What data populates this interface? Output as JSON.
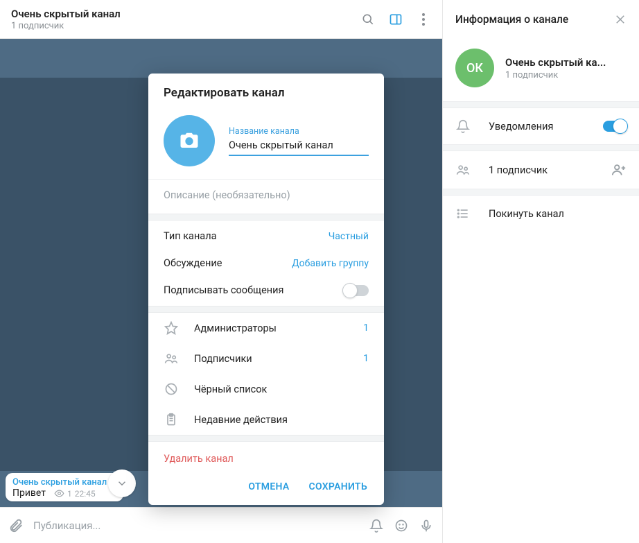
{
  "header": {
    "title": "Очень скрытый канал",
    "subtitle": "1 подписчик"
  },
  "message": {
    "channel": "Очень скрытый канал",
    "text": "Привет",
    "views": "1",
    "time": "22:45"
  },
  "composer": {
    "placeholder": "Публикация..."
  },
  "modal": {
    "title": "Редактировать канал",
    "name_label": "Название канала",
    "name_value": "Очень скрытый канал",
    "description_placeholder": "Описание (необязательно)",
    "type_label": "Тип канала",
    "type_value": "Частный",
    "discussion_label": "Обсуждение",
    "discussion_action": "Добавить группу",
    "sign_label": "Подписывать сообщения",
    "admins_label": "Администраторы",
    "admins_count": "1",
    "subscribers_label": "Подписчики",
    "subscribers_count": "1",
    "blacklist_label": "Чёрный список",
    "recent_label": "Недавние действия",
    "delete_label": "Удалить канал",
    "cancel": "ОТМЕНА",
    "save": "СОХРАНИТЬ"
  },
  "info": {
    "header": "Информация о канале",
    "avatar_initials": "ОК",
    "name": "Очень скрытый ка...",
    "subtitle": "1 подписчик",
    "notifications": "Уведомления",
    "subscribers": "1 подписчик",
    "leave": "Покинуть канал"
  }
}
